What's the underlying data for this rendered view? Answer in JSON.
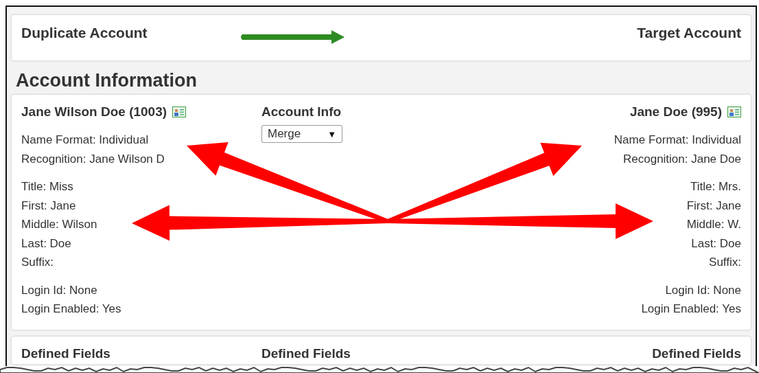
{
  "header": {
    "left_title": "Duplicate Account",
    "right_title": "Target Account"
  },
  "section_title": "Account Information",
  "merge_column": {
    "title": "Account Info",
    "select": {
      "value": "Merge",
      "caret": "▼"
    }
  },
  "accounts": [
    {
      "heading": "Jane Wilson Doe (1003)",
      "groups": [
        [
          "Name Format: Individual",
          "Recognition: Jane Wilson D"
        ],
        [
          "Title: Miss",
          "First: Jane",
          "Middle: Wilson",
          "Last: Doe",
          "Suffix:"
        ],
        [
          "Login Id: None",
          "Login Enabled: Yes"
        ]
      ]
    },
    {
      "heading": "Jane Doe (995)",
      "groups": [
        [
          "Name Format: Individual",
          "Recognition: Jane Doe"
        ],
        [
          "Title: Mrs.",
          "First: Jane",
          "Middle: W.",
          "Last: Doe",
          "Suffix:"
        ],
        [
          "Login Id: None",
          "Login Enabled: Yes"
        ]
      ]
    }
  ],
  "defined_fields": [
    "Defined Fields",
    "Defined Fields",
    "Defined Fields"
  ]
}
